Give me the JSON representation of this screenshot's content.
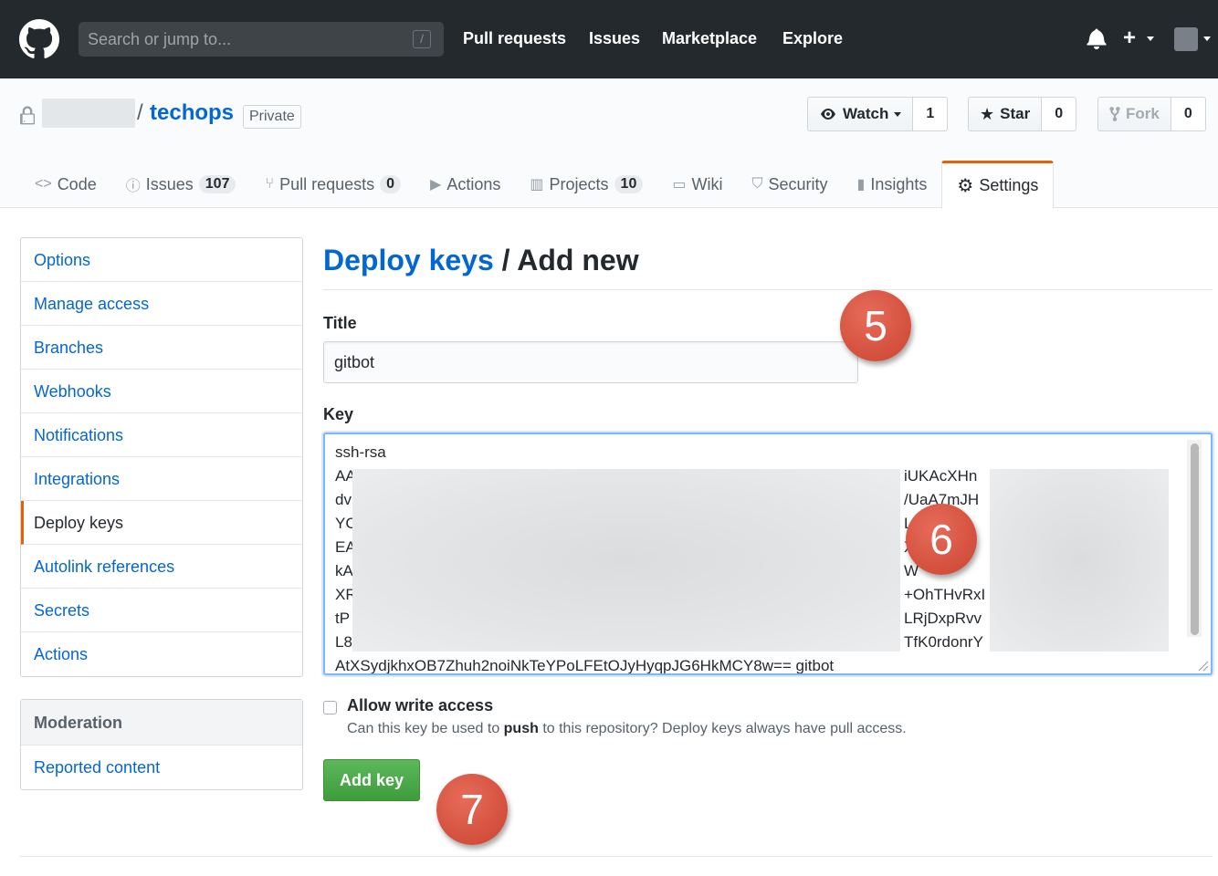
{
  "header": {
    "search_placeholder": "Search or jump to...",
    "search_shortcut": "/",
    "nav": [
      "Pull requests",
      "Issues",
      "Marketplace",
      "Explore"
    ]
  },
  "repo": {
    "name": "techops",
    "visibility": "Private",
    "watch_label": "Watch",
    "watch_count": "1",
    "star_label": "Star",
    "star_count": "0",
    "fork_label": "Fork",
    "fork_count": "0"
  },
  "tabs": [
    {
      "label": "Code",
      "icon": "code-icon"
    },
    {
      "label": "Issues",
      "count": "107",
      "icon": "issue-icon"
    },
    {
      "label": "Pull requests",
      "count": "0",
      "icon": "pull-request-icon"
    },
    {
      "label": "Actions",
      "icon": "play-icon"
    },
    {
      "label": "Projects",
      "count": "10",
      "icon": "project-icon"
    },
    {
      "label": "Wiki",
      "icon": "book-icon"
    },
    {
      "label": "Security",
      "icon": "shield-icon"
    },
    {
      "label": "Insights",
      "icon": "graph-icon"
    },
    {
      "label": "Settings",
      "icon": "gear-icon",
      "selected": true
    }
  ],
  "sidebar": {
    "items": [
      "Options",
      "Manage access",
      "Branches",
      "Webhooks",
      "Notifications",
      "Integrations",
      "Deploy keys",
      "Autolink references",
      "Secrets",
      "Actions"
    ],
    "selected": "Deploy keys",
    "moderation_heading": "Moderation",
    "moderation_items": [
      "Reported content"
    ]
  },
  "main": {
    "title_link": "Deploy keys",
    "title_rest": " / Add new",
    "title_label": "Title",
    "title_value": "gitbot",
    "key_label": "Key",
    "key_lines": [
      "ssh-rsa",
      "AA",
      "dv",
      "YC",
      "EA",
      "kA",
      "XR",
      "tP",
      "L8",
      "AtXSydjkhxOB7Zhuh2noiNkTeYPoLFEtOJyHyqpJG6HkMCY8w== gitbot"
    ],
    "key_visible_right": [
      "iUKAcXHn",
      "/UaA7mJH",
      "L",
      "X",
      "W",
      "+OhTHvRxI",
      "LRjDxpRvv",
      "TfK0rdonrY"
    ],
    "allow_write_label": "Allow write access",
    "note_before": "Can this key be used to ",
    "note_bold": "push",
    "note_after": " to this repository? Deploy keys always have pull access.",
    "add_button": "Add key"
  },
  "callouts": [
    "5",
    "6",
    "7"
  ],
  "colors": {
    "header_bg": "#24292e",
    "link": "#0366d6",
    "accent_tab": "#e36209",
    "button_green": "#3f9c3b",
    "callout_red": "#d2503c"
  }
}
